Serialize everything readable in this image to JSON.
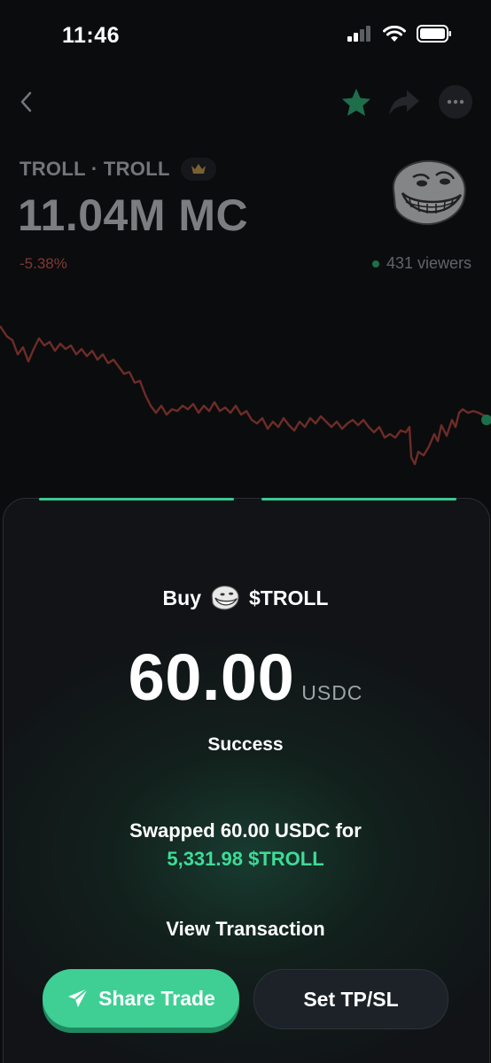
{
  "status_bar": {
    "time": "11:46"
  },
  "token": {
    "name": "TROLL · TROLL",
    "market_cap": "11.04M MC",
    "change": "-5.38%",
    "viewers": "431 viewers"
  },
  "colors": {
    "accent": "#3fcf94",
    "positive": "#3ddc97",
    "negative": "#e05a4e",
    "star": "#1f8f5a",
    "crown": "#d4a84a"
  },
  "icons": [
    "back-chevron-icon",
    "star-icon",
    "share-icon",
    "more-icon",
    "crown-icon",
    "paper-plane-icon",
    "signal-icon",
    "wifi-icon",
    "battery-icon"
  ],
  "trade": {
    "action": "Buy",
    "symbol": "$TROLL",
    "amount": "60.00",
    "unit": "USDC",
    "status": "Success",
    "swapped_text": "Swapped 60.00 USDC for",
    "received_text": "5,331.98 $TROLL",
    "view_transaction": "View Transaction"
  },
  "buttons": {
    "share_trade": "Share Trade",
    "set_tp_sl": "Set TP/SL"
  }
}
